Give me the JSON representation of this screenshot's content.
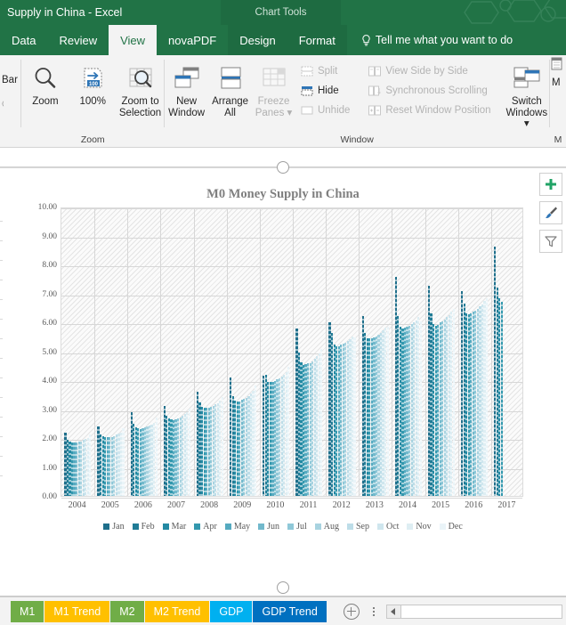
{
  "titlebar": {
    "document_title": "Supply in China  -  Excel",
    "contextual_tools": "Chart Tools"
  },
  "tabs": [
    {
      "label": "Data",
      "active": false
    },
    {
      "label": "Review",
      "active": false
    },
    {
      "label": "View",
      "active": true
    },
    {
      "label": "novaPDF",
      "active": false
    },
    {
      "label": "Design",
      "active": false,
      "contextual": true
    },
    {
      "label": "Format",
      "active": false,
      "contextual": true
    }
  ],
  "tellme": {
    "label": "Tell me what you want to do",
    "icon": "lightbulb-icon"
  },
  "ribbon": {
    "cut_left_label": "Bar",
    "cut_right_label": "M",
    "groups": [
      {
        "title": "Zoom",
        "buttons": [
          {
            "label": "Zoom",
            "icon": "magnifier-icon",
            "enabled": true
          },
          {
            "label": "100%",
            "icon": "hundred-percent-icon",
            "enabled": true
          },
          {
            "label": "Zoom to\nSelection",
            "icon": "zoom-to-selection-icon",
            "enabled": true
          }
        ]
      },
      {
        "title": "Window",
        "buttons": [
          {
            "label": "New\nWindow",
            "icon": "new-window-icon",
            "enabled": true
          },
          {
            "label": "Arrange\nAll",
            "icon": "arrange-all-icon",
            "enabled": true
          },
          {
            "label": "Freeze\nPanes ▾",
            "icon": "freeze-panes-icon",
            "enabled": false
          }
        ],
        "small_col_1": [
          {
            "label": "Split",
            "icon": "split-icon",
            "enabled": false
          },
          {
            "label": "Hide",
            "icon": "hide-icon",
            "enabled": true
          },
          {
            "label": "Unhide",
            "icon": "unhide-icon",
            "enabled": false
          }
        ],
        "small_col_2": [
          {
            "label": "View Side by Side",
            "icon": "view-side-by-side-icon",
            "enabled": false
          },
          {
            "label": "Synchronous Scrolling",
            "icon": "synchronous-scrolling-icon",
            "enabled": false
          },
          {
            "label": "Reset Window Position",
            "icon": "reset-window-position-icon",
            "enabled": false
          }
        ],
        "switch_windows": {
          "label": "Switch\nWindows ▾",
          "icon": "switch-windows-icon",
          "enabled": true
        }
      }
    ]
  },
  "chart_buttons": [
    {
      "name": "chart-elements-button",
      "icon": "plus-icon",
      "color": "#21A366"
    },
    {
      "name": "chart-styles-button",
      "icon": "paintbrush-icon",
      "color": "#2E75B6"
    },
    {
      "name": "chart-filters-button",
      "icon": "funnel-icon",
      "color": "#808080"
    }
  ],
  "sheet_tabs": [
    {
      "label": "M1",
      "color": "#70AD47",
      "active": false
    },
    {
      "label": "M1 Trend",
      "color": "#FFC000",
      "active": false
    },
    {
      "label": "M2",
      "color": "#70AD47",
      "active": false
    },
    {
      "label": "M2 Trend",
      "color": "#FFC000",
      "active": false
    },
    {
      "label": "GDP",
      "color": "#00B0F0",
      "active": false
    },
    {
      "label": "GDP Trend",
      "color": "#0070C0",
      "active": true
    }
  ],
  "chart_data": {
    "type": "bar",
    "title": "M0 Money Supply in China",
    "xlabel": "",
    "ylabel": "",
    "ylim": [
      0,
      10
    ],
    "ytick_step": 1,
    "ytick_format": "0.00",
    "ytick_labels": [
      "0.00",
      "1.00",
      "2.00",
      "3.00",
      "4.00",
      "5.00",
      "6.00",
      "7.00",
      "8.00",
      "9.00",
      "10.00"
    ],
    "grid": true,
    "legend_position": "bottom",
    "categories": [
      "2004",
      "2005",
      "2006",
      "2007",
      "2008",
      "2009",
      "2010",
      "2011",
      "2012",
      "2013",
      "2014",
      "2015",
      "2016",
      "2017"
    ],
    "series_colors": [
      "#1F6F8B",
      "#217C96",
      "#2389A3",
      "#3398AE",
      "#55AAC0",
      "#72B9CC",
      "#8FC8D8",
      "#A8D3E0",
      "#BDDDE8",
      "#CFE6EE",
      "#DEEEF3",
      "#EAF4F8"
    ],
    "series": [
      {
        "name": "Jan",
        "color": "#1F6F8B",
        "values": [
          2.18,
          2.4,
          2.88,
          3.11,
          3.61,
          4.09,
          4.16,
          5.77,
          5.99,
          6.22,
          7.57,
          7.26,
          7.09,
          8.61
        ]
      },
      {
        "name": "Feb",
        "color": "#217C96",
        "values": [
          1.95,
          2.13,
          2.49,
          2.78,
          3.24,
          3.44,
          4.19,
          4.96,
          5.62,
          5.62,
          6.22,
          6.31,
          6.66,
          7.19
        ]
      },
      {
        "name": "Mar",
        "color": "#2389A3",
        "values": [
          1.88,
          2.05,
          2.38,
          2.68,
          3.09,
          3.3,
          3.95,
          4.61,
          5.23,
          5.46,
          5.84,
          5.94,
          6.31,
          6.82
        ]
      },
      {
        "name": "Apr",
        "color": "#3398AE",
        "values": [
          1.86,
          2.03,
          2.33,
          2.65,
          3.05,
          3.27,
          3.93,
          4.53,
          5.18,
          5.44,
          5.8,
          5.88,
          6.28,
          6.71
        ]
      },
      {
        "name": "May",
        "color": "#55AAC0",
        "values": [
          1.85,
          2.02,
          2.32,
          2.63,
          3.04,
          3.27,
          3.94,
          4.54,
          5.18,
          5.45,
          5.81,
          5.9,
          6.3,
          null
        ]
      },
      {
        "name": "Jun",
        "color": "#72B9CC",
        "values": [
          1.86,
          2.03,
          2.34,
          2.65,
          3.06,
          3.33,
          3.98,
          4.58,
          5.22,
          5.48,
          5.86,
          5.99,
          6.38,
          null
        ]
      },
      {
        "name": "Jul",
        "color": "#8FC8D8",
        "values": [
          1.87,
          2.04,
          2.36,
          2.68,
          3.08,
          3.36,
          4.03,
          4.6,
          5.26,
          5.51,
          5.88,
          6.03,
          6.4,
          null
        ]
      },
      {
        "name": "Aug",
        "color": "#A8D3E0",
        "values": [
          1.89,
          2.07,
          2.39,
          2.71,
          3.12,
          3.4,
          4.07,
          4.65,
          5.3,
          5.57,
          5.93,
          6.09,
          6.45,
          null
        ]
      },
      {
        "name": "Sep",
        "color": "#BDDDE8",
        "values": [
          1.93,
          2.11,
          2.42,
          2.77,
          3.17,
          3.46,
          4.12,
          4.73,
          5.36,
          5.64,
          6.0,
          6.17,
          6.54,
          null
        ]
      },
      {
        "name": "Oct",
        "color": "#CFE6EE",
        "values": [
          1.96,
          2.15,
          2.47,
          2.82,
          3.21,
          3.54,
          4.19,
          4.82,
          5.43,
          5.72,
          6.06,
          6.26,
          6.61,
          null
        ]
      },
      {
        "name": "Nov",
        "color": "#DEEEF3",
        "values": [
          2.0,
          2.2,
          2.53,
          2.88,
          3.28,
          3.63,
          4.27,
          4.92,
          5.51,
          5.81,
          6.17,
          6.37,
          6.73,
          null
        ]
      },
      {
        "name": "Dec",
        "color": "#EAF4F8",
        "values": [
          2.11,
          2.34,
          2.71,
          3.03,
          3.42,
          3.82,
          4.46,
          5.07,
          5.47,
          5.86,
          6.03,
          6.47,
          6.83,
          null
        ]
      }
    ]
  }
}
